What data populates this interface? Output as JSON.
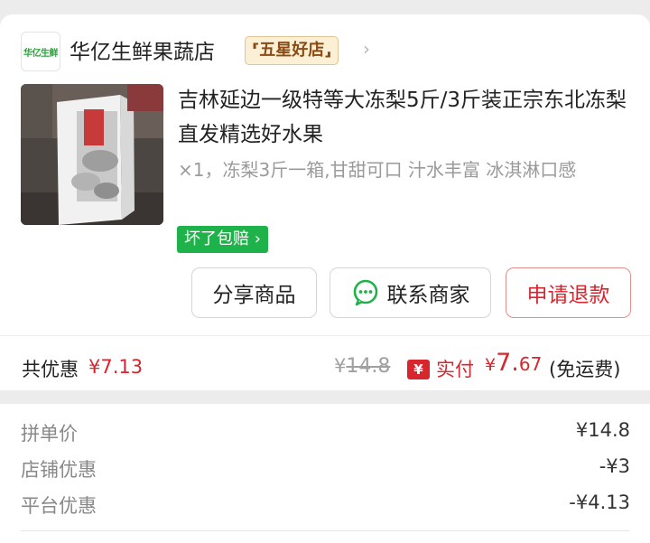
{
  "store": {
    "logo_text": "华亿生鲜",
    "name": "华亿生鲜果蔬店",
    "badge": "五星好店",
    "chevron_icon": "chevron-right-icon"
  },
  "product": {
    "title": "吉林延边一级特等大冻梨5斤/3斤装正宗东北冻梨直发精选好水果",
    "spec": "×1，冻梨3斤一箱,甘甜可口 汁水丰富 冰淇淋口感",
    "guarantee": "坏了包赔"
  },
  "actions": {
    "share": "分享商品",
    "contact": "联系商家",
    "contact_icon": "chat-bubble-icon",
    "refund": "申请退款"
  },
  "totals": {
    "discount_label": "共优惠",
    "discount_value": "¥7.13",
    "orig_currency": "¥",
    "orig_price": "14.8",
    "paid_icon_glyph": "¥",
    "paid_label": "实付",
    "paid_currency": "¥",
    "paid_int": "7.",
    "paid_dec": "67",
    "shipping_note": "(免运费)"
  },
  "breakdown": [
    {
      "label": "拼单价",
      "value": "¥14.8"
    },
    {
      "label": "店铺优惠",
      "value": "-¥3"
    },
    {
      "label": "平台优惠",
      "value": "-¥4.13"
    }
  ],
  "colors": {
    "accent_red": "#d8262e",
    "guarantee_green": "#20b24a",
    "badge_gold": "#fbefd6"
  }
}
